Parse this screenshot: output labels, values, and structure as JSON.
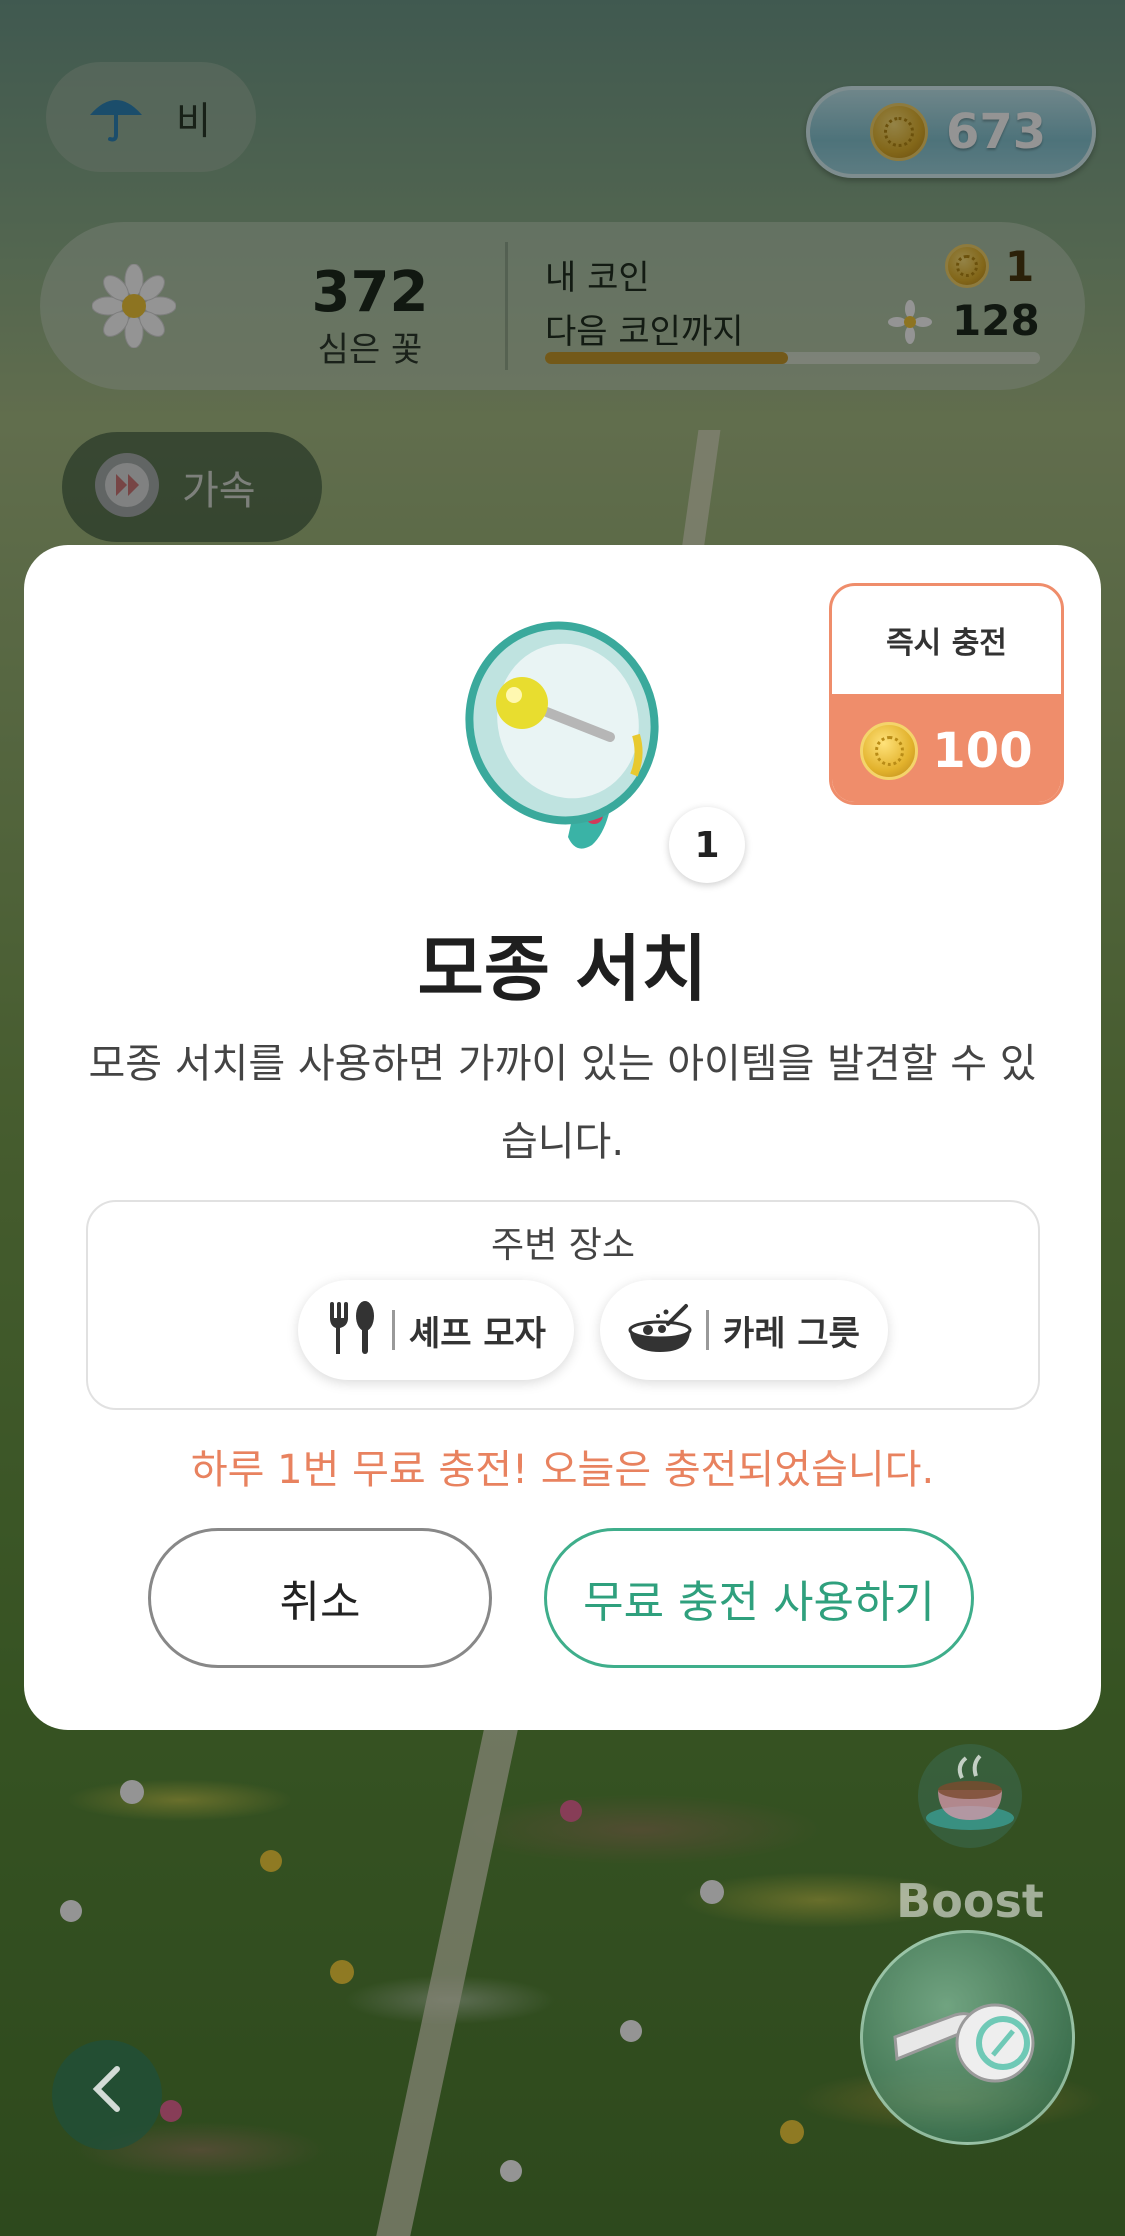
{
  "hud": {
    "weather_label": "비",
    "coins": "673",
    "planted_count": "372",
    "planted_label": "심은 꽃",
    "my_coin_label": "내 코인",
    "my_coin_value": "1",
    "next_coin_label": "다음 코인까지",
    "next_coin_value": "128",
    "next_coin_progress": 0.49,
    "accelerate_label": "가속",
    "boost_label": "Boost"
  },
  "modal": {
    "instant_charge_label": "즉시 충전",
    "instant_charge_price": "100",
    "item_count": "1",
    "title": "모종 서치",
    "description": "모종 서치를 사용하면 가까이 있는 아이템을  발견할 수 있습니다.",
    "nearby_title": "주변 장소",
    "nearby_places": [
      {
        "icon": "fork-knife-icon",
        "label": "셰프 모자"
      },
      {
        "icon": "curry-bowl-icon",
        "label": "카레 그릇"
      }
    ],
    "notice": "하루 1번 무료 충전! 오늘은 충전되었습니다.",
    "cancel_label": "취소",
    "free_charge_label": "무료 충전 사용하기"
  },
  "colors": {
    "accent_orange": "#ef8d6b",
    "accent_green": "#3fae8b",
    "notice_text": "#e8825f"
  }
}
